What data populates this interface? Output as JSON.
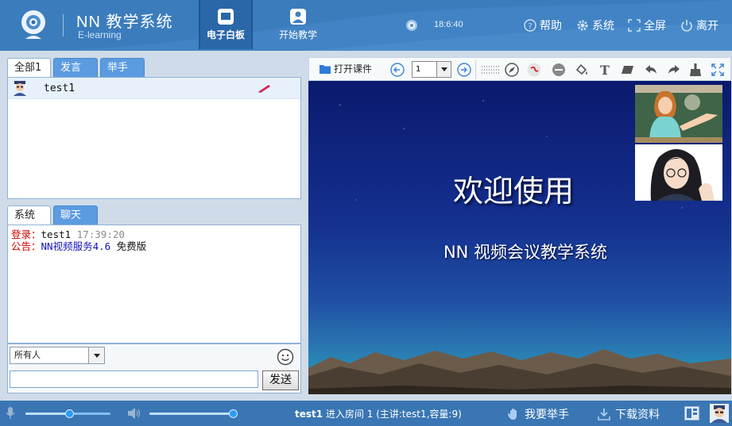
{
  "header": {
    "app_title": "NN 教学系统",
    "app_subtitle": "E-learning",
    "modes": [
      {
        "label": "电子白板",
        "active": true,
        "icon": "whiteboard-icon"
      },
      {
        "label": "开始教学",
        "active": false,
        "icon": "teacher-icon"
      }
    ],
    "clock": "18:6:40",
    "buttons": {
      "help": "帮助",
      "settings": "系统",
      "fullscreen": "全屏",
      "leave": "离开"
    }
  },
  "user_panel": {
    "tabs": [
      "全部1",
      "发言",
      "举手"
    ],
    "active_tab": 0,
    "users": [
      {
        "name": "test1",
        "icon": "user-avatar",
        "pen_icon": "pen-icon"
      }
    ]
  },
  "message_panel": {
    "tabs": [
      "系统",
      "聊天"
    ],
    "active_tab": 0,
    "messages": [
      {
        "label": "登录：",
        "user": "test1",
        "time": "17:39:20"
      },
      {
        "label": "公告：",
        "text": "NN视频服务4.6",
        "extra": " 免费版"
      }
    ],
    "recipient": "所有人",
    "input_value": "",
    "send_label": "发送"
  },
  "whiteboard": {
    "open_label": "打开课件",
    "page": "1",
    "tools": [
      "prev-page-icon",
      "next-page-icon",
      "dotted-select-icon",
      "compass-icon",
      "pen-icon",
      "line-icon",
      "fill-icon",
      "text-icon",
      "eraser-icon",
      "undo-icon",
      "redo-icon",
      "clear-brush-icon",
      "fullscreen-icon"
    ],
    "slide_title": "欢迎使用",
    "slide_subtitle": "NN 视频会议教学系统"
  },
  "footer": {
    "mic_level": 0.52,
    "speaker_level": 1.0,
    "status_user": "test1",
    "status_text": " 进入房间 1 (主讲:test1,容量:9)",
    "raise_hand": "我要举手",
    "download": "下载资料"
  },
  "colors": {
    "header_bg": "#3d7fc0",
    "tab_blue": "#5b9be0",
    "system_label": "#d40000",
    "notice_text": "#1515b8",
    "bottom_bar": "#3a76b4"
  }
}
